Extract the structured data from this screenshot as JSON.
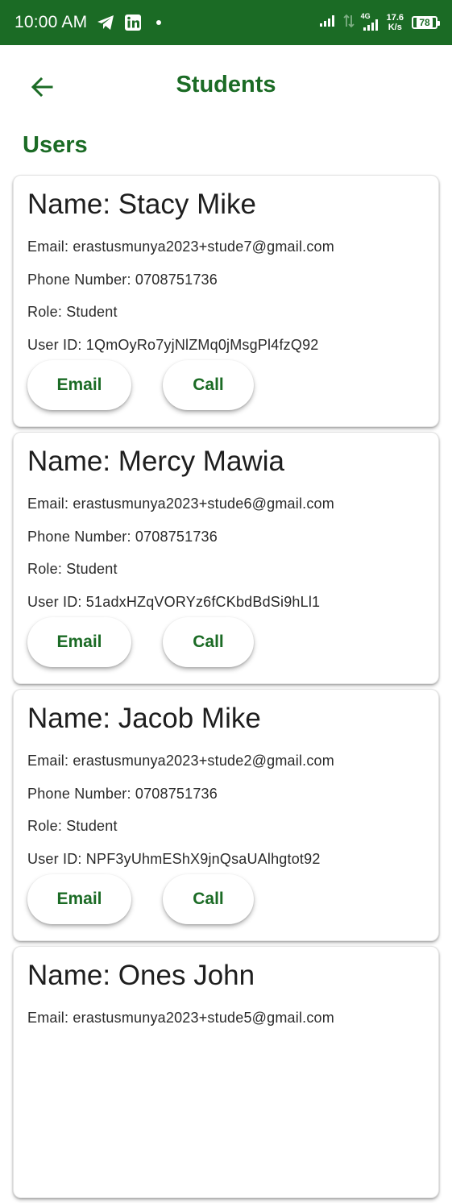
{
  "status_bar": {
    "time": "10:00 AM",
    "net_speed_value": "17.6",
    "net_speed_unit": "K/s",
    "network_label": "4G",
    "battery": "78"
  },
  "app_bar": {
    "title": "Students"
  },
  "section": {
    "title": "Users"
  },
  "colors": {
    "brand_green": "#1b6b25"
  },
  "users": [
    {
      "name": "Name: Stacy Mike",
      "email": "Email: erastusmunya2023+stude7@gmail.com",
      "phone": "Phone Number: 0708751736",
      "role": "Role: Student",
      "user_id": "User ID: 1QmOyRo7yjNlZMq0jMsgPl4fzQ92",
      "email_label": "Email",
      "call_label": "Call"
    },
    {
      "name": "Name: Mercy Mawia",
      "email": "Email: erastusmunya2023+stude6@gmail.com",
      "phone": "Phone Number: 0708751736",
      "role": "Role: Student",
      "user_id": "User ID: 51adxHZqVORYz6fCKbdBdSi9hLl1",
      "email_label": "Email",
      "call_label": "Call"
    },
    {
      "name": "Name: Jacob Mike",
      "email": "Email: erastusmunya2023+stude2@gmail.com",
      "phone": "Phone Number: 0708751736",
      "role": "Role: Student",
      "user_id": "User ID: NPF3yUhmEShX9jnQsaUAlhgtot92",
      "email_label": "Email",
      "call_label": "Call"
    },
    {
      "name": "Name: Ones John",
      "email": "Email: erastusmunya2023+stude5@gmail.com",
      "phone": "",
      "role": "",
      "user_id": "",
      "email_label": "",
      "call_label": ""
    }
  ]
}
